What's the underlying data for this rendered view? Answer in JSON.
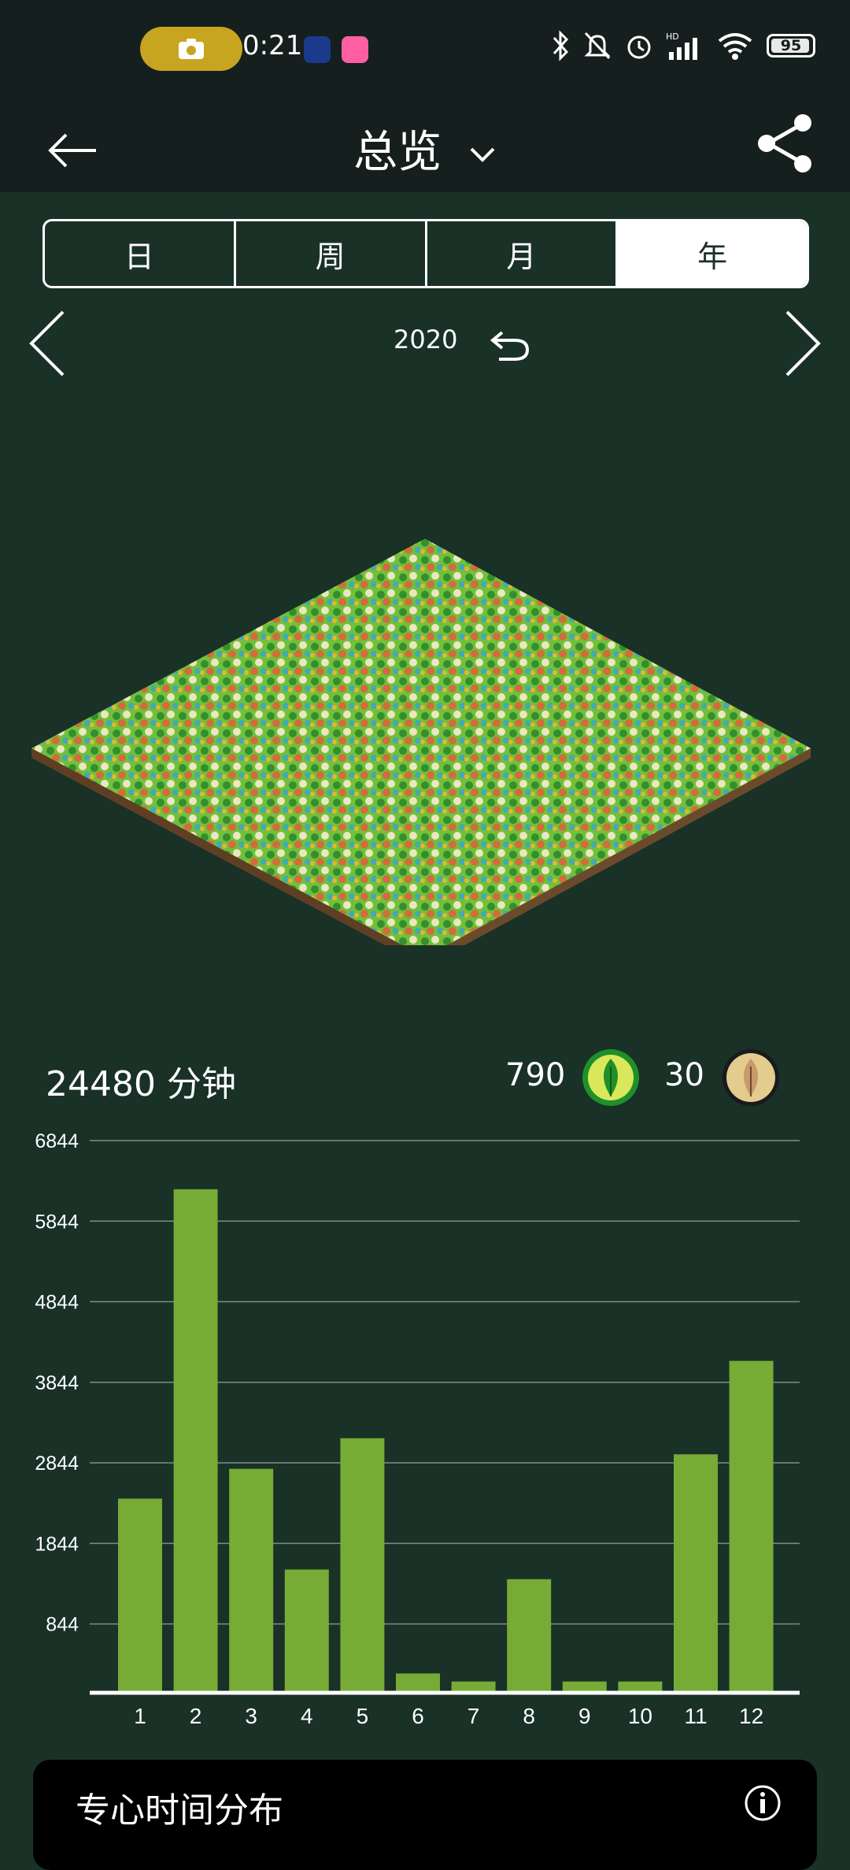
{
  "status_bar": {
    "time": "0:21",
    "battery": "95",
    "icons": [
      "camera-icon",
      "app-icon-1",
      "app-icon-2",
      "bluetooth-icon",
      "mute-icon",
      "alarm-icon",
      "signal-icon",
      "wifi-icon",
      "battery-icon"
    ]
  },
  "header": {
    "title": "总览",
    "back_icon": "arrow-left-icon",
    "dropdown_icon": "chevron-down-icon",
    "share_icon": "share-icon"
  },
  "tabs": [
    {
      "label": "日",
      "active": false
    },
    {
      "label": "周",
      "active": false
    },
    {
      "label": "月",
      "active": false
    },
    {
      "label": "年",
      "active": true
    }
  ],
  "period": {
    "label": "2020",
    "prev_icon": "chevron-left-icon",
    "next_icon": "chevron-right-icon",
    "reset_icon": "undo-icon"
  },
  "forest": {
    "image_icon": "isometric-forest-image"
  },
  "stats": {
    "minutes": "24480 分钟",
    "healthy_trees": "790",
    "withered_trees": "30",
    "colors": {
      "healthy_ring": "#1f8f2a",
      "healthy_fill": "#d9e85a",
      "withered_fill": "#e2cc8e"
    }
  },
  "chart_data": {
    "type": "bar",
    "categories": [
      "1",
      "2",
      "3",
      "4",
      "5",
      "6",
      "7",
      "8",
      "9",
      "10",
      "11",
      "12"
    ],
    "values": [
      2400,
      6240,
      2770,
      1520,
      3150,
      230,
      130,
      1400,
      130,
      130,
      2950,
      4110
    ],
    "yticks": [
      "6844",
      "5844",
      "4844",
      "3844",
      "2844",
      "1844",
      "844"
    ],
    "ytick_values": [
      6844,
      5844,
      4844,
      3844,
      2844,
      1844,
      844
    ],
    "ylim": [
      0,
      6844
    ],
    "bar_color": "#76ab35",
    "grid": true
  },
  "bottom_card": {
    "title": "专心时间分布",
    "info_icon": "info-icon"
  }
}
